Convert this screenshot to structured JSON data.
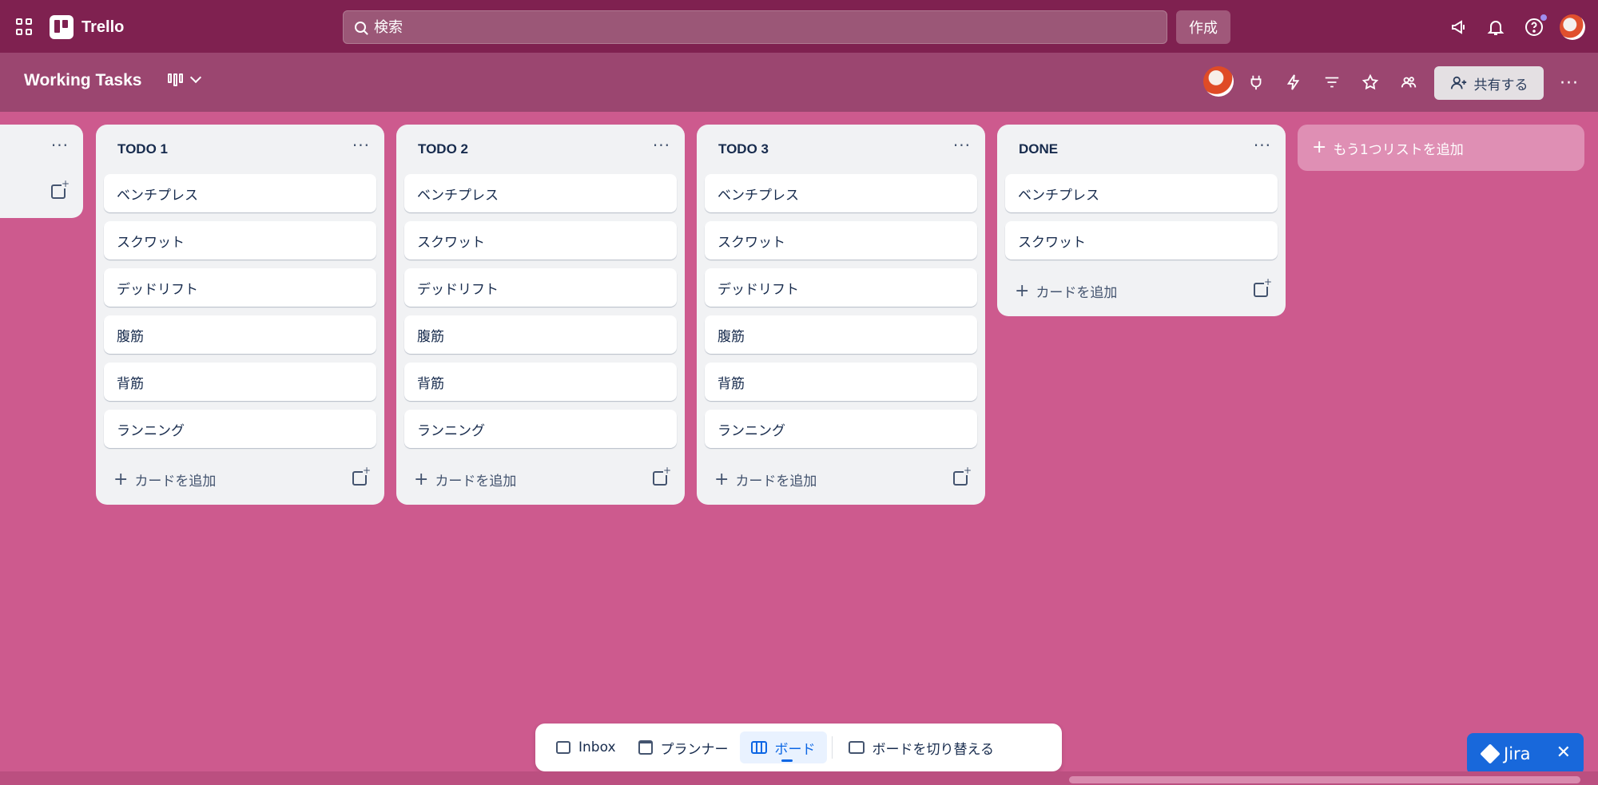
{
  "topnav": {
    "app_name": "Trello",
    "search_placeholder": "検索",
    "create_label": "作成"
  },
  "board": {
    "title": "Working Tasks",
    "share_label": "共有する"
  },
  "lists": [
    {
      "title": "TODO 1",
      "cards": [
        "ベンチプレス",
        "スクワット",
        "デッドリフト",
        "腹筋",
        "背筋",
        "ランニング"
      ],
      "add_card": "カードを追加"
    },
    {
      "title": "TODO 2",
      "cards": [
        "ベンチプレス",
        "スクワット",
        "デッドリフト",
        "腹筋",
        "背筋",
        "ランニング"
      ],
      "add_card": "カードを追加"
    },
    {
      "title": "TODO 3",
      "cards": [
        "ベンチプレス",
        "スクワット",
        "デッドリフト",
        "腹筋",
        "背筋",
        "ランニング"
      ],
      "add_card": "カードを追加"
    },
    {
      "title": "DONE",
      "cards": [
        "ベンチプレス",
        "スクワット"
      ],
      "add_card": "カードを追加"
    }
  ],
  "add_list_label": "もう1つリストを追加",
  "bottom_nav": {
    "inbox": "Inbox",
    "planner": "プランナー",
    "board": "ボード",
    "switch_board": "ボードを切り替える"
  },
  "jira": {
    "label": "Jira"
  },
  "colors": {
    "topnav_bg": "#7f2150",
    "board_bg": "#cd5a8e",
    "list_bg": "#f1f2f4",
    "accent": "#0c66e4"
  }
}
